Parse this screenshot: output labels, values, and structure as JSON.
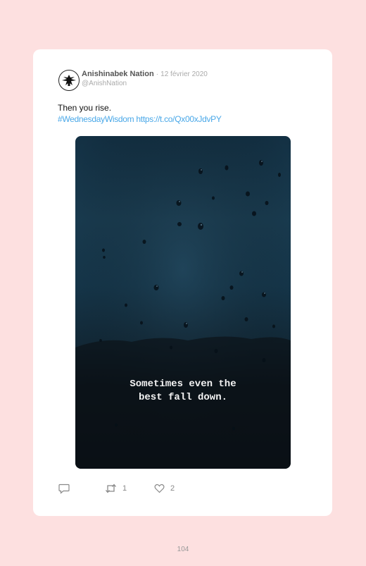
{
  "tweet": {
    "author_name": "Anishinabek Nation",
    "separator": "·",
    "date": "12 février 2020",
    "handle": "@AnishNation",
    "text": "Then you rise.",
    "hashtag": "#WednesdayWisdom",
    "link": "https://t.co/Qx00xJdvPY",
    "media_caption_line1": "Sometimes even the",
    "media_caption_line2": "best fall down.",
    "reply_icon": "speech-bubble-icon",
    "retweet_icon": "retweet-icon",
    "like_icon": "heart-icon",
    "retweet_count": "1",
    "like_count": "2"
  },
  "page": {
    "number": "104"
  },
  "colors": {
    "background": "#fde0e0",
    "card": "#ffffff",
    "link": "#4aa8e8"
  }
}
